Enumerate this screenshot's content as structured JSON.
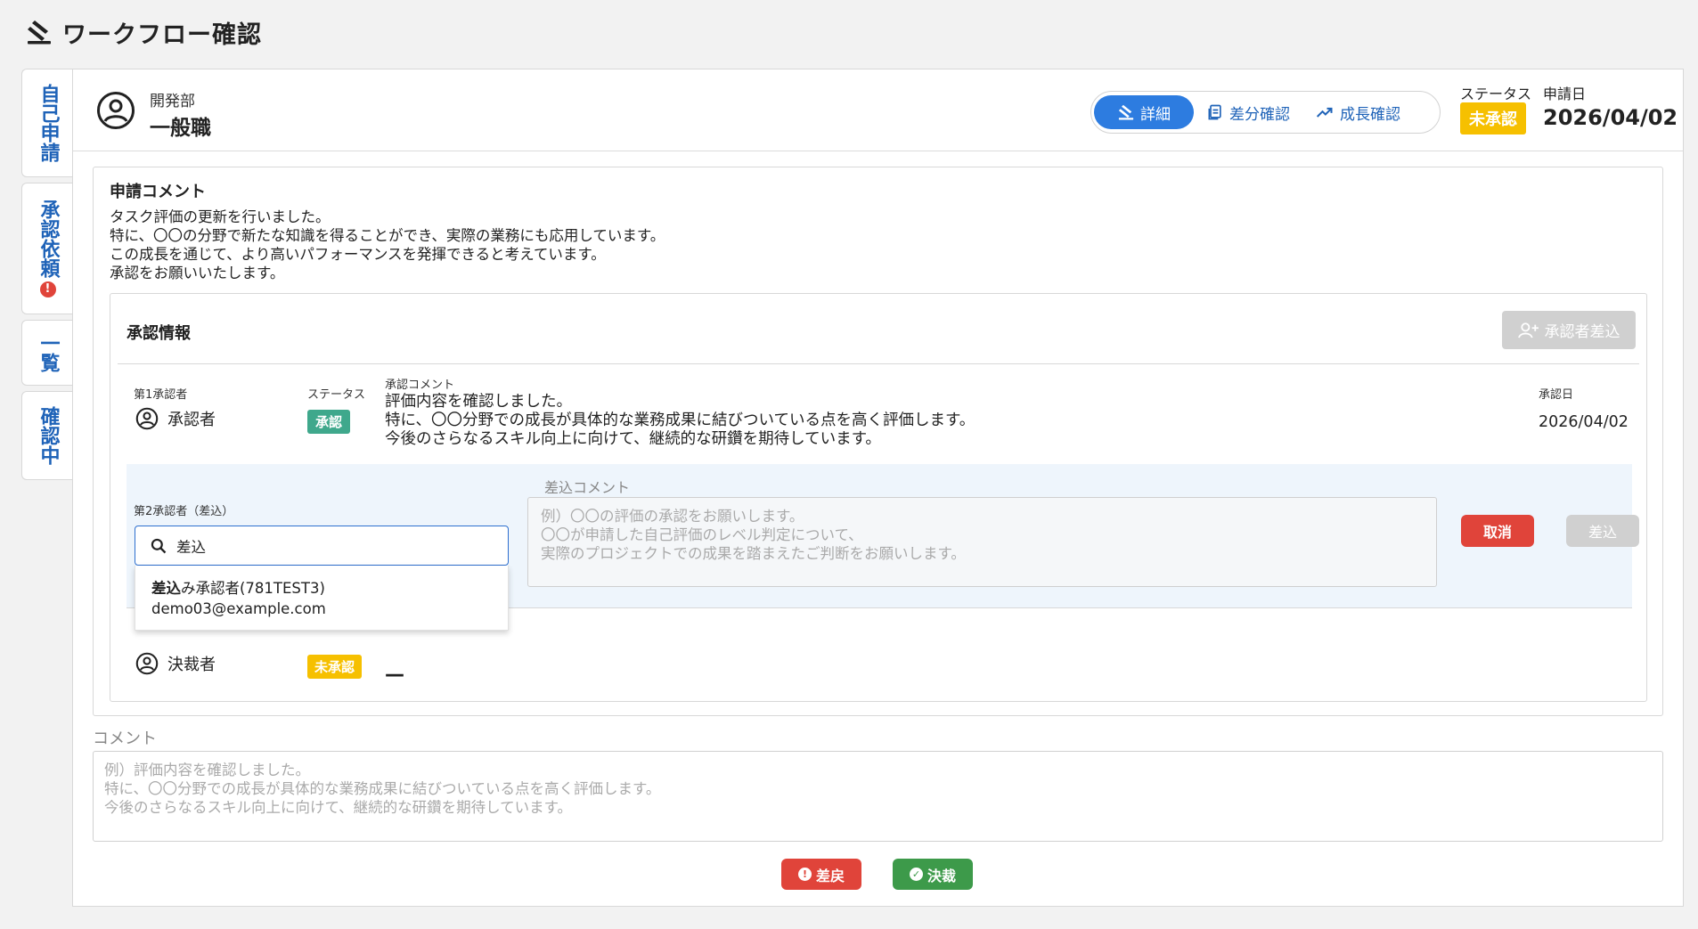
{
  "header": {
    "title": "ワークフロー確認",
    "icon": "gavel-icon"
  },
  "sidetabs": [
    {
      "label": "自己申請",
      "alert": false
    },
    {
      "label": "承認依頼",
      "alert": true,
      "alert_mark": "!"
    },
    {
      "label": "一覧",
      "alert": false
    },
    {
      "label": "確認中",
      "alert": false
    }
  ],
  "applicant": {
    "department": "開発部",
    "role": "一般職"
  },
  "view_tabs": {
    "detail": "詳細",
    "diff": "差分確認",
    "growth": "成長確認"
  },
  "status": {
    "label": "ステータス",
    "value": "未承認"
  },
  "apply_date": {
    "label": "申請日",
    "value": "2026/04/02"
  },
  "apply_comment": {
    "title": "申請コメント",
    "lines": [
      "タスク評価の更新を行いました。",
      "特に、〇〇の分野で新たな知識を得ることができ、実際の業務にも応用しています。",
      "この成長を通じて、より高いパフォーマンスを発揮できると考えています。",
      "承認をお願いいたします。"
    ]
  },
  "approval": {
    "title": "承認情報",
    "add_button": "承認者差込",
    "first": {
      "label": "第1承認者",
      "name": "承認者",
      "status_label": "ステータス",
      "status": "承認",
      "comment_label": "承認コメント",
      "comment_lines": [
        "評価内容を確認しました。",
        "特に、〇〇分野での成長が具体的な業務成果に結びついている点を高く評価します。",
        "今後のさらなるスキル向上に向けて、継続的な研鑽を期待しています。"
      ],
      "date_label": "承認日",
      "date": "2026/04/02"
    },
    "second": {
      "label": "第2承認者（差込）",
      "search_value": "差込",
      "comment_label": "差込コメント",
      "comment_placeholder_lines": [
        "例）〇〇の評価の承認をお願いします。",
        "〇〇が申請した自己評価のレベル判定について、",
        "実際のプロジェクトでの成果を踏まえたご判断をお願いします。"
      ],
      "cancel_button": "取消",
      "insert_button": "差込",
      "suggestion": {
        "match": "差込",
        "rest": "み承認者(781TEST3)",
        "email": "demo03@example.com"
      }
    },
    "final": {
      "name": "決裁者",
      "status": "未承認",
      "comment": "—"
    }
  },
  "comment": {
    "label": "コメント",
    "placeholder_lines": [
      "例）評価内容を確認しました。",
      "特に、〇〇分野での成長が具体的な業務成果に結びついている点を高く評価します。",
      "今後のさらなるスキル向上に向けて、継続的な研鑽を期待しています。"
    ]
  },
  "actions": {
    "return_button": "差戻",
    "decide_button": "決裁"
  },
  "colors": {
    "accent": "#2d7ce0",
    "danger": "#e0443a",
    "success": "#3d9a4a",
    "warning": "#f6c000",
    "approved": "#3fa88c"
  }
}
